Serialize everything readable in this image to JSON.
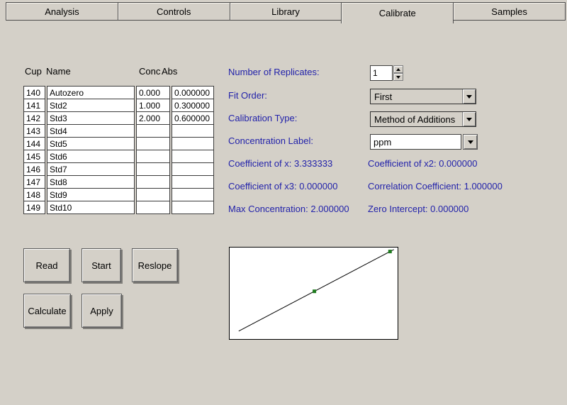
{
  "colors": {
    "background": "#d4d0c8",
    "label_blue": "#2222aa",
    "marker_green": "#1e7b1e"
  },
  "tabs": [
    {
      "label": "Analysis",
      "active": false
    },
    {
      "label": "Controls",
      "active": false
    },
    {
      "label": "Library",
      "active": false
    },
    {
      "label": "Calibrate",
      "active": true
    },
    {
      "label": "Samples",
      "active": false
    }
  ],
  "table": {
    "headers": [
      "Cup",
      "Name",
      "Conc",
      "Abs"
    ],
    "rows": [
      [
        "140",
        "Autozero",
        "0.000",
        "0.000000"
      ],
      [
        "141",
        "Std2",
        "1.000",
        "0.300000"
      ],
      [
        "142",
        "Std3",
        "2.000",
        "0.600000"
      ],
      [
        "143",
        "Std4",
        "",
        ""
      ],
      [
        "144",
        "Std5",
        "",
        ""
      ],
      [
        "145",
        "Std6",
        "",
        ""
      ],
      [
        "146",
        "Std7",
        "",
        ""
      ],
      [
        "147",
        "Std8",
        "",
        ""
      ],
      [
        "148",
        "Std9",
        "",
        ""
      ],
      [
        "149",
        "Std10",
        "",
        ""
      ]
    ]
  },
  "fields": {
    "replicates": {
      "label": "Number of Replicates:",
      "value": "1"
    },
    "fit_order": {
      "label": "Fit Order:",
      "value": "First"
    },
    "calibration_type": {
      "label": "Calibration Type:",
      "value": "Method of Additions"
    },
    "concentration_label": {
      "label": "Concentration Label:",
      "value": "ppm"
    }
  },
  "stats": {
    "coeff_x": "Coefficient of x: 3.333333",
    "coeff_x2": "Coefficient of x2: 0.000000",
    "coeff_x3": "Coefficient of x3: 0.000000",
    "correlation": "Correlation Coefficient: 1.000000",
    "max_concentration": "Max Concentration: 2.000000",
    "zero_intercept": "Zero Intercept: 0.000000"
  },
  "buttons": {
    "read": "Read",
    "start": "Start",
    "reslope": "Reslope",
    "calculate": "Calculate",
    "apply": "Apply"
  },
  "chart_data": {
    "type": "line",
    "title": "",
    "xlabel": "",
    "ylabel": "",
    "grid": false,
    "series": [
      {
        "name": "calibration-fit-line",
        "x": [
          0.0,
          2.05
        ],
        "y": [
          0.0,
          0.615
        ]
      }
    ],
    "points": [
      {
        "x": 1.0,
        "y": 0.3
      },
      {
        "x": 2.0,
        "y": 0.6
      }
    ],
    "xlim": [
      -0.12,
      2.1
    ],
    "ylim": [
      -0.06,
      0.63
    ],
    "line_color": "#000000",
    "marker_color": "#1e7b1e"
  }
}
